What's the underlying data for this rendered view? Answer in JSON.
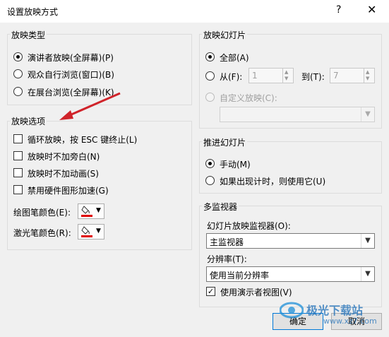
{
  "dialog": {
    "title": "设置放映方式",
    "help": "?",
    "close": "✕"
  },
  "show_type": {
    "legend": "放映类型",
    "options": [
      "演讲者放映(全屏幕)(P)",
      "观众自行浏览(窗口)(B)",
      "在展台浏览(全屏幕)(K)"
    ],
    "selected_index": 0
  },
  "show_options": {
    "legend": "放映选项",
    "checkboxes": [
      "循环放映，按 ESC 键终止(L)",
      "放映时不加旁白(N)",
      "放映时不加动画(S)",
      "禁用硬件图形加速(G)"
    ],
    "pen_color_label": "绘图笔颜色(E):",
    "laser_color_label": "激光笔颜色(R):",
    "pen_color": "#e00000",
    "laser_color": "#e00000"
  },
  "slides": {
    "legend": "放映幻灯片",
    "all_label": "全部(A)",
    "from_label": "从(F):",
    "from_value": "1",
    "to_label": "到(T):",
    "to_value": "7",
    "custom_label": "自定义放映(C):",
    "custom_value": ""
  },
  "advance": {
    "legend": "推进幻灯片",
    "manual_label": "手动(M)",
    "timing_label": "如果出现计时，则使用它(U)",
    "selected_index": 0
  },
  "monitors": {
    "legend": "多监视器",
    "monitor_label": "幻灯片放映监视器(O):",
    "monitor_value": "主监视器",
    "resolution_label": "分辨率(T):",
    "resolution_value": "使用当前分辨率",
    "presenter_view_label": "使用演示者视图(V)",
    "presenter_view_checked": true
  },
  "buttons": {
    "ok": "确定",
    "cancel": "取消"
  },
  "watermark": {
    "text": "极光下载站",
    "url": "www.xz7.com"
  }
}
